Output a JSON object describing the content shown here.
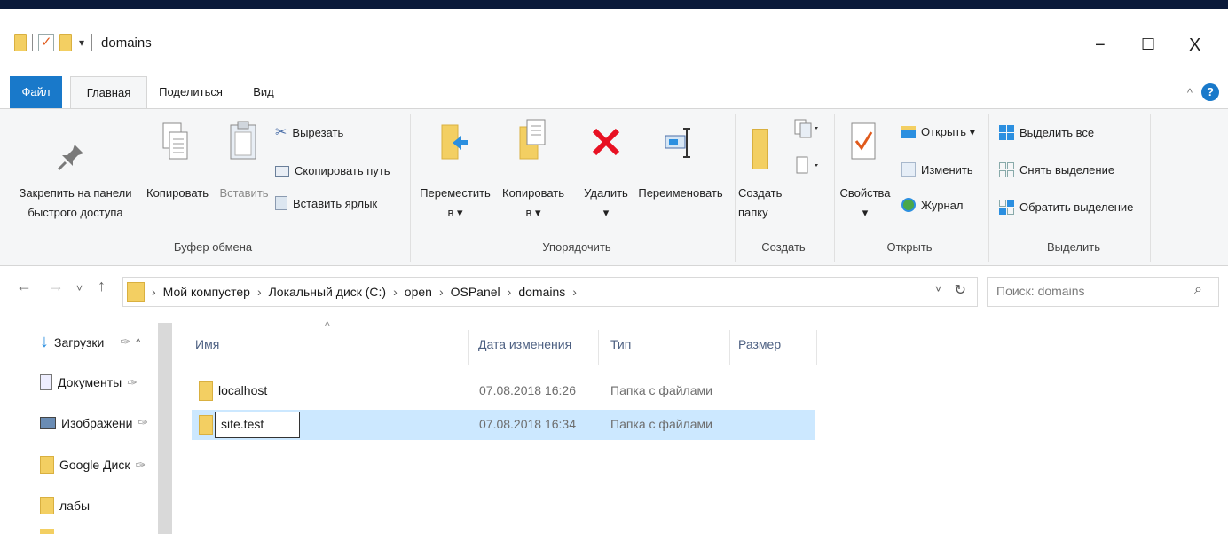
{
  "window": {
    "title": "domains",
    "minimize": "−",
    "maximize": "☐",
    "close": "X"
  },
  "menu": {
    "file": "Файл",
    "home": "Главная",
    "share": "Поделиться",
    "view": "Вид",
    "help": "?"
  },
  "ribbon": {
    "clipboard": {
      "pin": "Закрепить на панели быстрого доступа",
      "pin_line1": "Закрепить на панели",
      "pin_line2": "быстрого доступа",
      "copy": "Копировать",
      "paste": "Вставить",
      "cut": "Вырезать",
      "copy_path": "Скопировать путь",
      "paste_shortcut": "Вставить ярлык",
      "label": "Буфер обмена"
    },
    "organize": {
      "move_to_1": "Переместить",
      "move_to_2": "в ▾",
      "copy_to_1": "Копировать",
      "copy_to_2": "в ▾",
      "delete_1": "Удалить",
      "delete_2": "▾",
      "rename": "Переименовать",
      "label": "Упорядочить"
    },
    "new": {
      "new_folder_1": "Создать",
      "new_folder_2": "папку",
      "label": "Создать"
    },
    "open": {
      "properties_1": "Свойства",
      "properties_2": "▾",
      "open": "Открыть ▾",
      "edit": "Изменить",
      "history": "Журнал",
      "label": "Открыть"
    },
    "select": {
      "select_all": "Выделить все",
      "select_none": "Снять выделение",
      "invert": "Обратить выделение",
      "label": "Выделить"
    }
  },
  "address": {
    "crumbs": [
      "Мой компустер",
      "Локальный диск (C:)",
      "open",
      "OSPanel",
      "domains"
    ],
    "search_placeholder": "Поиск: domains"
  },
  "nav_pane": [
    "Загрузки",
    "Документы",
    "Изображени",
    "Google Диск",
    "лабы"
  ],
  "columns": {
    "name": "Имя",
    "date": "Дата изменения",
    "type": "Тип",
    "size": "Размер"
  },
  "files": [
    {
      "name": "localhost",
      "date": "07.08.2018 16:26",
      "type": "Папка с файлами",
      "size": ""
    },
    {
      "name": "site.test",
      "date": "07.08.2018 16:34",
      "type": "Папка с файлами",
      "size": "",
      "selected": true,
      "editing": true
    }
  ],
  "colors": {
    "accent": "#1979ca",
    "selection": "#cce8ff",
    "folder": "#f3cf62",
    "delete": "#e81123"
  }
}
